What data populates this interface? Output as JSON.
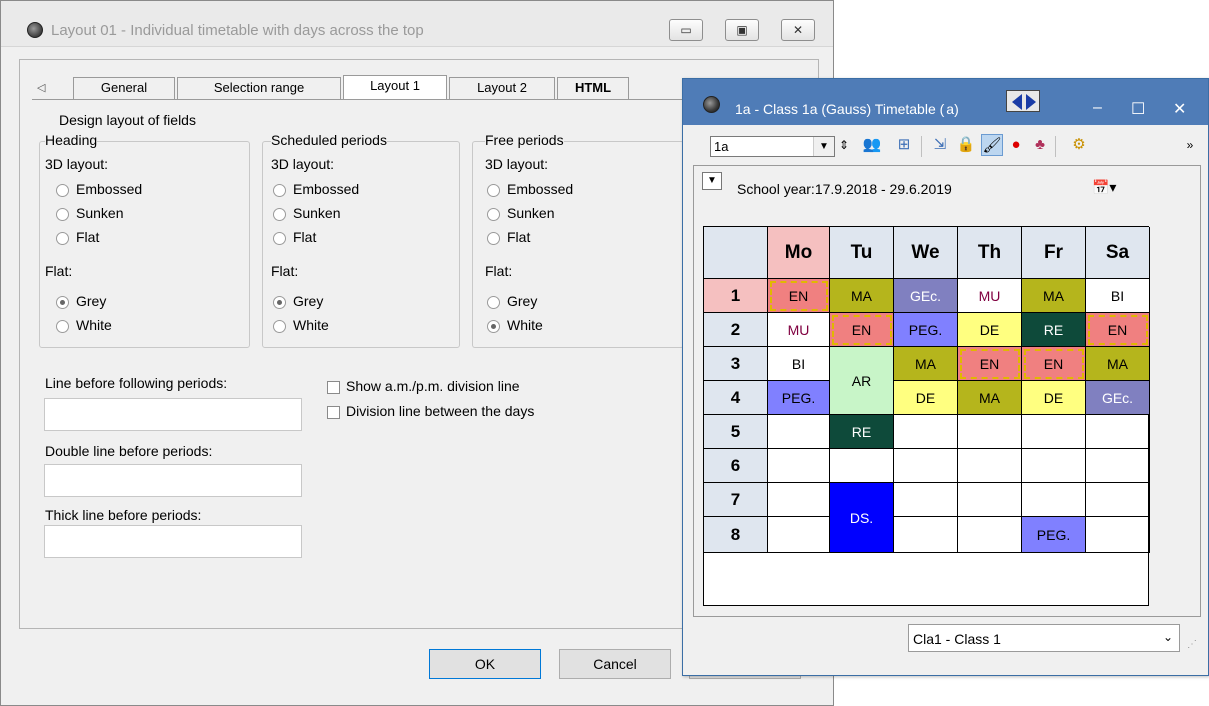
{
  "dialog": {
    "title": "Layout 01 - Individual timetable with days across the top",
    "window_buttons": [
      "minimize",
      "maximize",
      "close"
    ],
    "tabs": [
      "General",
      "Selection range",
      "Layout 1",
      "Layout 2",
      "HTML"
    ],
    "active_tab": "Layout 1",
    "section_title": "Design layout of fields",
    "groups": [
      {
        "title": "Heading",
        "layout_label": "3D layout:",
        "options_3d": [
          "Embossed",
          "Sunken",
          "Flat"
        ],
        "flat_label": "Flat:",
        "options_flat": [
          "Grey",
          "White"
        ],
        "selected_flat": "Grey"
      },
      {
        "title": "Scheduled periods",
        "layout_label": "3D layout:",
        "options_3d": [
          "Embossed",
          "Sunken",
          "Flat"
        ],
        "flat_label": "Flat:",
        "options_flat": [
          "Grey",
          "White"
        ],
        "selected_flat": "Grey"
      },
      {
        "title": "Free periods",
        "layout_label": "3D layout:",
        "options_3d": [
          "Embossed",
          "Sunken",
          "Flat"
        ],
        "flat_label": "Flat:",
        "options_flat": [
          "Grey",
          "White"
        ],
        "selected_flat": "White"
      }
    ],
    "line_fields": [
      {
        "label": "Line before following periods:",
        "value": ""
      },
      {
        "label": "Double line before periods:",
        "value": ""
      },
      {
        "label": "Thick line before periods:",
        "value": ""
      }
    ],
    "checkboxes": [
      {
        "label": "Show a.m./p.m. division line",
        "checked": false
      },
      {
        "label": "Division line between the days",
        "checked": false
      }
    ],
    "ok_label": "OK",
    "cancel_label": "Cancel"
  },
  "timetable": {
    "title": "1a - Class 1a (Gauss)  Timetable  (",
    "title_suffix": "a)",
    "class_selector": "1a",
    "school_year": "School year:17.9.2018 - 29.6.2019",
    "days": [
      "Mo",
      "Tu",
      "We",
      "Th",
      "Fr",
      "Sa"
    ],
    "periods": [
      "1",
      "2",
      "3",
      "4",
      "5",
      "6",
      "7",
      "8"
    ],
    "lessons": [
      {
        "day": 0,
        "period": 0,
        "span": 1,
        "text": "EN",
        "bg": "#f08080",
        "hatch": true,
        "color": "#000"
      },
      {
        "day": 1,
        "period": 0,
        "span": 1,
        "text": "MA",
        "bg": "#b5b51c",
        "hatch": false,
        "color": "#000"
      },
      {
        "day": 2,
        "period": 0,
        "span": 1,
        "text": "GEc.",
        "bg": "#8080c0",
        "hatch": false,
        "color": "#fff"
      },
      {
        "day": 3,
        "period": 0,
        "span": 1,
        "text": "MU",
        "bg": "#ffffff",
        "hatch": false,
        "color": "#800040"
      },
      {
        "day": 4,
        "period": 0,
        "span": 1,
        "text": "MA",
        "bg": "#b5b51c",
        "hatch": false,
        "color": "#000"
      },
      {
        "day": 5,
        "period": 0,
        "span": 1,
        "text": "BI",
        "bg": "#ffffff",
        "hatch": false,
        "color": "#000"
      },
      {
        "day": 0,
        "period": 1,
        "span": 1,
        "text": "MU",
        "bg": "#ffffff",
        "hatch": false,
        "color": "#800040"
      },
      {
        "day": 1,
        "period": 1,
        "span": 1,
        "text": "EN",
        "bg": "#f08080",
        "hatch": true,
        "color": "#000"
      },
      {
        "day": 2,
        "period": 1,
        "span": 1,
        "text": "PEG.",
        "bg": "#8080ff",
        "hatch": false,
        "color": "#000"
      },
      {
        "day": 3,
        "period": 1,
        "span": 1,
        "text": "DE",
        "bg": "#ffff80",
        "hatch": false,
        "color": "#000"
      },
      {
        "day": 4,
        "period": 1,
        "span": 1,
        "text": "RE",
        "bg": "#0e4a3a",
        "hatch": false,
        "color": "#fff"
      },
      {
        "day": 5,
        "period": 1,
        "span": 1,
        "text": "EN",
        "bg": "#f08080",
        "hatch": true,
        "color": "#000"
      },
      {
        "day": 0,
        "period": 2,
        "span": 1,
        "text": "BI",
        "bg": "#ffffff",
        "hatch": false,
        "color": "#000"
      },
      {
        "day": 1,
        "period": 2,
        "span": 2,
        "text": "AR",
        "bg": "#c8f5c8",
        "hatch": false,
        "color": "#000"
      },
      {
        "day": 2,
        "period": 2,
        "span": 1,
        "text": "MA",
        "bg": "#b5b51c",
        "hatch": false,
        "color": "#000"
      },
      {
        "day": 3,
        "period": 2,
        "span": 1,
        "text": "EN",
        "bg": "#f08080",
        "hatch": true,
        "color": "#000"
      },
      {
        "day": 4,
        "period": 2,
        "span": 1,
        "text": "EN",
        "bg": "#f08080",
        "hatch": true,
        "color": "#000"
      },
      {
        "day": 5,
        "period": 2,
        "span": 1,
        "text": "MA",
        "bg": "#b5b51c",
        "hatch": false,
        "color": "#000"
      },
      {
        "day": 0,
        "period": 3,
        "span": 1,
        "text": "PEG.",
        "bg": "#8080ff",
        "hatch": false,
        "color": "#000"
      },
      {
        "day": 2,
        "period": 3,
        "span": 1,
        "text": "DE",
        "bg": "#ffff80",
        "hatch": false,
        "color": "#000"
      },
      {
        "day": 3,
        "period": 3,
        "span": 1,
        "text": "MA",
        "bg": "#b5b51c",
        "hatch": false,
        "color": "#000"
      },
      {
        "day": 4,
        "period": 3,
        "span": 1,
        "text": "DE",
        "bg": "#ffff80",
        "hatch": false,
        "color": "#000"
      },
      {
        "day": 5,
        "period": 3,
        "span": 1,
        "text": "GEc.",
        "bg": "#8080c0",
        "hatch": false,
        "color": "#fff"
      },
      {
        "day": 1,
        "period": 4,
        "span": 1,
        "text": "RE",
        "bg": "#0e4a3a",
        "hatch": false,
        "color": "#fff"
      },
      {
        "day": 1,
        "period": 6,
        "span": 2,
        "text": "DS.",
        "bg": "#0000ff",
        "hatch": false,
        "color": "#fff"
      },
      {
        "day": 4,
        "period": 7,
        "span": 1,
        "text": "PEG.",
        "bg": "#8080ff",
        "hatch": false,
        "color": "#000"
      }
    ],
    "bottom_selector": "Cla1 - Class 1"
  }
}
